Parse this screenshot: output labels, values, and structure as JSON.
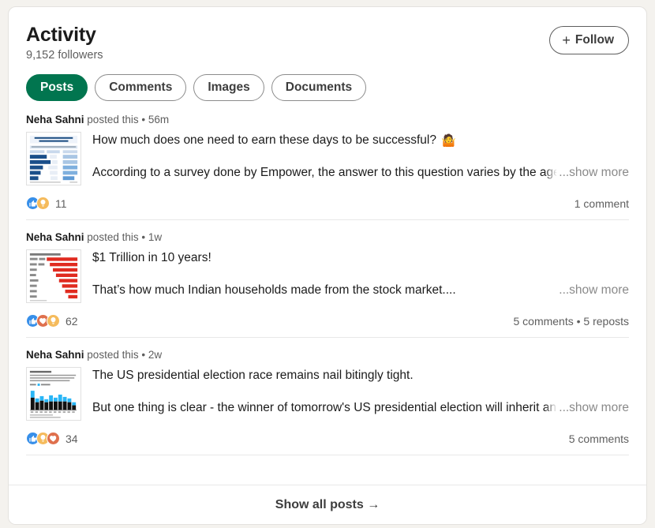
{
  "header": {
    "title": "Activity",
    "followers": "9,152 followers",
    "follow_label": "Follow",
    "follow_plus": "+"
  },
  "tabs": [
    {
      "label": "Posts",
      "active": true
    },
    {
      "label": "Comments",
      "active": false
    },
    {
      "label": "Images",
      "active": false
    },
    {
      "label": "Documents",
      "active": false
    }
  ],
  "posts": [
    {
      "author": "Neha Sahni",
      "action": "posted this",
      "separator": "•",
      "time": "56m",
      "line1": "How much does one need to earn these days to be successful?",
      "emoji": "🤷",
      "line2": "According to a survey done by Empower, the answer to this question varies by the age g",
      "show_more": "...show more",
      "reaction_count": "11",
      "reaction_types": [
        "like",
        "insight"
      ],
      "meta": "1 comment",
      "thumb": "blue-bar-chart"
    },
    {
      "author": "Neha Sahni",
      "action": "posted this",
      "separator": "•",
      "time": "1w",
      "line1": "$1 Trillion in 10 years!",
      "emoji": "",
      "line2": "That’s how much Indian households made from the stock market....",
      "show_more": "...show more",
      "reaction_count": "62",
      "reaction_types": [
        "like",
        "love",
        "insight"
      ],
      "meta": "5 comments • 5 reposts",
      "thumb": "red-bar-chart"
    },
    {
      "author": "Neha Sahni",
      "action": "posted this",
      "separator": "•",
      "time": "2w",
      "line1": "The US presidential election race remains nail bitingly tight.",
      "emoji": "",
      "line2": "But one thing is clear - the winner of tomorrow's US presidential election will inherit an e",
      "show_more": "...show more",
      "reaction_count": "34",
      "reaction_types": [
        "like",
        "insight",
        "love"
      ],
      "meta": "5 comments",
      "thumb": "black-blue-column-chart"
    }
  ],
  "footer": {
    "show_all_label": "Show all posts →"
  },
  "colors": {
    "brand_green": "#01754f",
    "like_blue": "#378fe9",
    "insight_yellow": "#f5bb5c",
    "love_red": "#df704d",
    "page_bg": "#f4f2ee",
    "card_bg": "#ffffff",
    "text_primary": "#1b1b1b",
    "text_secondary": "#5e5e5e"
  }
}
